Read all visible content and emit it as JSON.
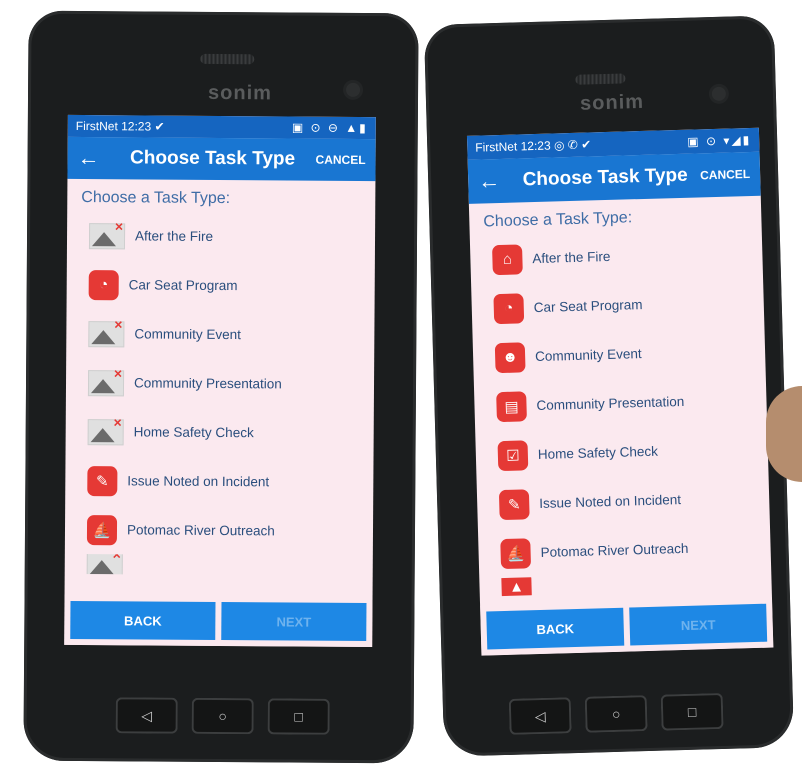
{
  "phones": [
    {
      "brand": "sonim",
      "status": {
        "carrier_time": "FirstNet 12:23 ✔",
        "indicators": "▣ ⊙ ⊖ ▲▮"
      },
      "app_bar": {
        "back_icon": "←",
        "title": "Choose Task Type",
        "cancel": "CANCEL"
      },
      "heading": "Choose a Task Type:",
      "items": [
        {
          "label": "After the Fire",
          "icon": "placeholder-image-icon"
        },
        {
          "label": "Car Seat Program",
          "icon": "car-seat-icon"
        },
        {
          "label": "Community Event",
          "icon": "placeholder-image-icon"
        },
        {
          "label": "Community Presentation",
          "icon": "placeholder-image-icon"
        },
        {
          "label": "Home Safety Check",
          "icon": "placeholder-image-icon"
        },
        {
          "label": "Issue Noted on Incident",
          "icon": "clipboard-icon"
        },
        {
          "label": "Potomac River Outreach",
          "icon": "boat-icon"
        }
      ],
      "buttons": {
        "back": "BACK",
        "next": "NEXT"
      },
      "nav": {
        "back": "◁",
        "home": "○",
        "recents": "□"
      }
    },
    {
      "brand": "sonim",
      "status": {
        "carrier_time": "FirstNet 12:23 ◎ ✆ ✔",
        "indicators": "▣ ⊙ ▾◢▮"
      },
      "app_bar": {
        "back_icon": "←",
        "title": "Choose Task Type",
        "cancel": "CANCEL"
      },
      "heading": "Choose a Task Type:",
      "items": [
        {
          "label": "After the Fire",
          "icon": "house-fire-icon"
        },
        {
          "label": "Car Seat Program",
          "icon": "car-seat-icon"
        },
        {
          "label": "Community Event",
          "icon": "people-icon"
        },
        {
          "label": "Community Presentation",
          "icon": "presentation-icon"
        },
        {
          "label": "Home Safety Check",
          "icon": "checklist-icon"
        },
        {
          "label": "Issue Noted on Incident",
          "icon": "clipboard-icon"
        },
        {
          "label": "Potomac River Outreach",
          "icon": "boat-icon"
        }
      ],
      "buttons": {
        "back": "BACK",
        "next": "NEXT"
      },
      "nav": {
        "back": "◁",
        "home": "○",
        "recents": "□"
      }
    }
  ],
  "colors": {
    "app_bar": "#1976d2",
    "status_bar": "#1565c0",
    "button": "#1e88e5",
    "icon_red": "#e53935",
    "text_blue": "#2a4e7d"
  }
}
